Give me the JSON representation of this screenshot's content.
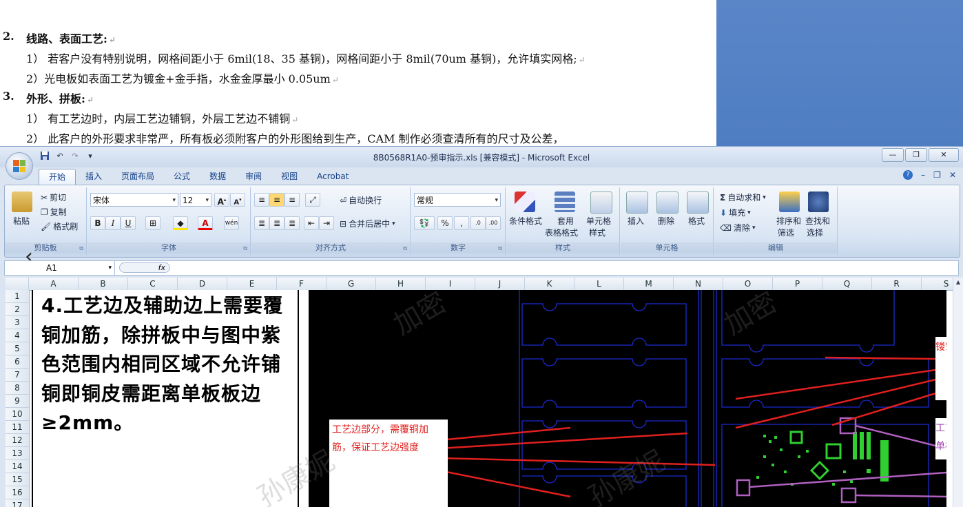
{
  "document": {
    "lines": [
      {
        "num": "2.",
        "text": "线路、表面工艺:",
        "bold": true
      },
      {
        "num": "",
        "text": "1） 若客户没有特别说明，网格间距小于 6mil(18、35 基铜)，网格间距小于 8mil(70um 基铜)，允许填实网格;",
        "bold": false
      },
      {
        "num": "",
        "text": "2）光电板如表面工艺为镀金+金手指，水金金厚最小 0.05um",
        "bold": false
      },
      {
        "num": "3.",
        "text": "外形、拼板:",
        "bold": true
      },
      {
        "num": "",
        "text": "1） 有工艺边时，内层工艺边铺铜，外层工艺边不铺铜",
        "bold": false
      },
      {
        "num": "",
        "text": "2） 此客户的外形要求非常严，所有板必须附客户的外形图给到生产，CAM 制作必须查清所有的尺寸及公差，",
        "bold": false
      }
    ]
  },
  "excel": {
    "title": "8B0568R1A0-预审指示.xls [兼容模式] - Microsoft Excel",
    "tabs": [
      "开始",
      "插入",
      "页面布局",
      "公式",
      "数据",
      "审阅",
      "视图",
      "Acrobat"
    ],
    "active_tab": "开始",
    "groups": {
      "clipboard": {
        "label": "剪贴板",
        "paste": "粘贴",
        "cut": "剪切",
        "copy": "复制",
        "format_painter": "格式刷"
      },
      "font": {
        "label": "字体",
        "font_name": "宋体",
        "font_size": "12"
      },
      "alignment": {
        "label": "对齐方式",
        "wrap": "自动换行",
        "merge": "合并后居中"
      },
      "number": {
        "label": "数字",
        "format": "常规"
      },
      "styles": {
        "label": "样式",
        "conditional": "条件格式",
        "table1": "套用",
        "table2": "表格格式",
        "cell1": "单元格",
        "cell2": "样式"
      },
      "cells": {
        "label": "单元格",
        "insert": "插入",
        "delete": "删除",
        "format": "格式"
      },
      "editing": {
        "label": "编辑",
        "autosum": "自动求和",
        "fill": "填充",
        "clear": "清除",
        "sort1": "排序和",
        "sort2": "筛选",
        "find1": "查找和",
        "find2": "选择"
      }
    },
    "name_box": "A1",
    "fx": "fx",
    "columns": [
      "A",
      "B",
      "C",
      "D",
      "E",
      "F",
      "G",
      "H",
      "I",
      "J",
      "K",
      "L",
      "M",
      "N",
      "O",
      "P",
      "Q",
      "R",
      "S"
    ],
    "rows": [
      "1",
      "2",
      "3",
      "4",
      "5",
      "6",
      "7",
      "8",
      "9",
      "10",
      "11",
      "12",
      "13",
      "14",
      "15",
      "16",
      "17"
    ],
    "textbox_text": "4.工艺边及辅助边上需要覆铜加筋，除拼板中与图中紫色范围内相同区域不允许铺铜即铜皮需距离单板板边≥2mm。",
    "note_left": "工艺边部分，需覆铜加筋，保证工艺边强度",
    "note_right1": "镂空",
    "note_right2a": "工艺",
    "note_right2b": "单板",
    "watermark": "加密",
    "watermark2": "孙康妮",
    "colors": {
      "accent_red": "#e0201e",
      "pcb_line": "#1a2bd0",
      "purple": "#b060c0",
      "green": "#2fd02f"
    }
  }
}
